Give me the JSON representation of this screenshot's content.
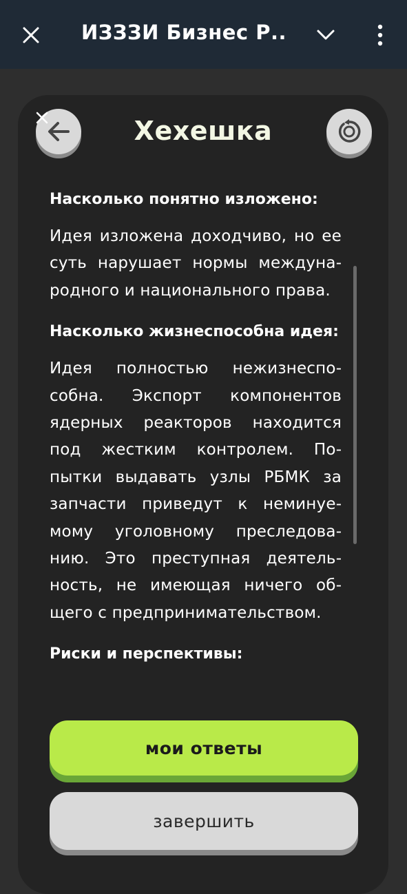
{
  "app_bar": {
    "title": "ИЗЗЗИ Бизнес Р...",
    "close_icon": "close-icon",
    "expand_icon": "chevron-down-icon",
    "menu_icon": "more-vert-icon"
  },
  "card": {
    "title": "Хехешка",
    "back_icon": "arrow-left-icon",
    "reset_icon": "restart-icon"
  },
  "sections": [
    {
      "heading": "Насколько понятно изложено:",
      "text": "Идея изложена доходчиво, но ее суть нарушает нормы междуна­родного и национального права."
    },
    {
      "heading": "Насколько жизнеспособна идея:",
      "text": "Идея полностью нежизнеспо­собна. Экспорт компонентов ядерных реакторов находится под жестким контролем. По­пытки выдавать узлы РБМК за запчасти приведут к неминуе­мому уголовному преследова­нию. Это преступная деятель­ность, не имеющая ничего об­щего с предпринимательством."
    },
    {
      "heading": "Риски и перспективы:",
      "text": ""
    }
  ],
  "buttons": {
    "answers": "мои ответы",
    "finish": "завершить"
  },
  "colors": {
    "app_bar_bg": "#1f2a36",
    "card_bg": "#232323",
    "accent_green": "#b9ea49",
    "secondary_gray": "#d9d9d9"
  }
}
